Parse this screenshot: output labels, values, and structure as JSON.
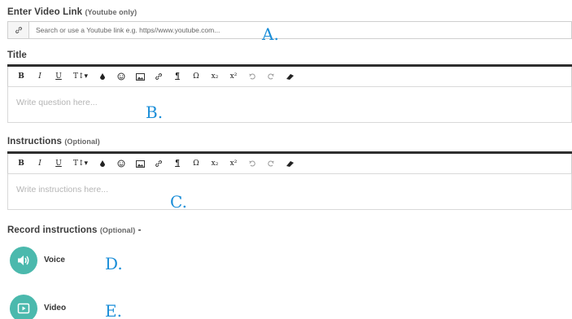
{
  "video_link": {
    "label": "Enter Video Link",
    "note": "(Youtube only)",
    "placeholder": "Search or use a Youtube link e.g. https//www.youtube.com...",
    "addon_icon": "link-icon",
    "marker": "A."
  },
  "title_section": {
    "label": "Title",
    "placeholder": "Write question here...",
    "marker": "B."
  },
  "instructions_section": {
    "label": "Instructions",
    "note": "(Optional)",
    "placeholder": "Write instructions here...",
    "marker": "C."
  },
  "toolbar": {
    "bold": "B",
    "italic": "I",
    "underline": "U",
    "text_size": "T↕▾",
    "color_icon": "ink-drop-icon",
    "emoji_icon": "smiley-icon",
    "image_icon": "image-icon",
    "link_icon": "link-icon",
    "paragraph": "¶",
    "omega": "Ω",
    "subscript": "x₂",
    "superscript": "x²",
    "undo_icon": "undo-icon",
    "redo_icon": "redo-icon",
    "eraser_icon": "eraser-icon"
  },
  "record": {
    "label": "Record instructions",
    "note": "(Optional)",
    "suffix": " -",
    "voice": {
      "label": "Voice",
      "icon": "speaker-icon",
      "marker": "D."
    },
    "video": {
      "label": "Video",
      "icon": "video-play-icon",
      "marker": "E."
    }
  },
  "colors": {
    "accent_teal": "#4bb9ad",
    "marker_blue": "#1b8ed8",
    "toolbar_top": "#2e2e2e"
  }
}
